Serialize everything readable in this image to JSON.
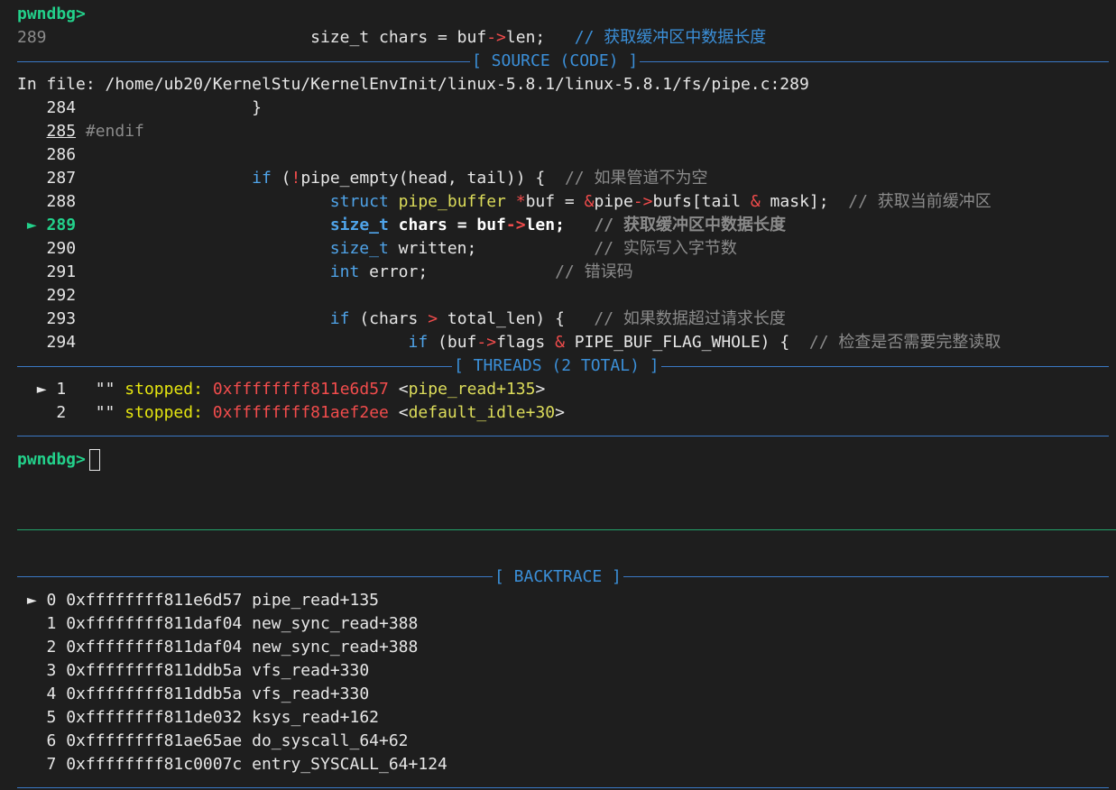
{
  "prompt": "pwndbg>",
  "top_line": {
    "lineno": "289",
    "code_a": "size_t chars = buf",
    "arrow": "->",
    "code_b": "len;",
    "comment": "// 获取缓冲区中数据长度"
  },
  "source": {
    "banner": "[ SOURCE (CODE) ]",
    "file_label": "In file: ",
    "file_path": "/home/ub20/KernelStu/KernelEnvInit/linux-5.8.1/linux-5.8.1/fs/pipe.c:289",
    "current_marker": "►",
    "lines": [
      {
        "no": "284",
        "text": "}"
      },
      {
        "no": "285",
        "text": "#endif"
      },
      {
        "no": "286",
        "text": ""
      },
      {
        "no": "287",
        "kw": "if",
        "p1": " (",
        "not": "!",
        "fn": "pipe_empty",
        "rest": "(head, tail)) {  ",
        "comment": "// 如果管道不为空"
      },
      {
        "no": "288",
        "kw": "struct",
        "type": "pipe_buffer",
        "star": " *",
        "rest1": "buf = ",
        "amp": "&",
        "rest2": "pipe",
        "arrow": "->",
        "rest3": "bufs[tail ",
        "amp2": "&",
        "rest4": " mask];  ",
        "comment": "// 获取当前缓冲区"
      },
      {
        "no": "289",
        "kw": "size_t",
        "rest1": " chars = buf",
        "arrow": "->",
        "rest2": "len;   ",
        "comment": "// 获取缓冲区中数据长度"
      },
      {
        "no": "290",
        "kw": "size_t",
        "rest1": " written;            ",
        "comment": "// 实际写入字节数"
      },
      {
        "no": "291",
        "kw": "int",
        "rest1": " error;             ",
        "comment": "// 错误码"
      },
      {
        "no": "292",
        "text": ""
      },
      {
        "no": "293",
        "kw": "if",
        "rest1": " (chars ",
        "gt": ">",
        "rest2": " total_len) {   ",
        "comment": "// 如果数据超过请求长度"
      },
      {
        "no": "294",
        "kw": "if",
        "rest1": " (buf",
        "arrow": "->",
        "rest2": "flags ",
        "amp": "&",
        "rest3": " PIPE_BUF_FLAG_WHOLE) {  ",
        "comment": "// 检查是否需要完整读取"
      }
    ]
  },
  "threads": {
    "banner": "[ THREADS (2 TOTAL) ]",
    "current_marker": "►",
    "items": [
      {
        "id": "1",
        "name": "\"\"",
        "state": "stopped:",
        "addr": "0xffffffff811e6d57",
        "sym": "pipe_read+135"
      },
      {
        "id": "2",
        "name": "\"\"",
        "state": "stopped:",
        "addr": "0xffffffff81aef2ee",
        "sym": "default_idle+30"
      }
    ]
  },
  "backtrace": {
    "banner": "[ BACKTRACE ]",
    "current_marker": "►",
    "frames": [
      {
        "n": "0",
        "addr": "0xffffffff811e6d57",
        "sym": "pipe_read+135"
      },
      {
        "n": "1",
        "addr": "0xffffffff811daf04",
        "sym": "new_sync_read+388"
      },
      {
        "n": "2",
        "addr": "0xffffffff811daf04",
        "sym": "new_sync_read+388"
      },
      {
        "n": "3",
        "addr": "0xffffffff811ddb5a",
        "sym": "vfs_read+330"
      },
      {
        "n": "4",
        "addr": "0xffffffff811ddb5a",
        "sym": "vfs_read+330"
      },
      {
        "n": "5",
        "addr": "0xffffffff811de032",
        "sym": "ksys_read+162"
      },
      {
        "n": "6",
        "addr": "0xffffffff81ae65ae",
        "sym": "do_syscall_64+62"
      },
      {
        "n": "7",
        "addr": "0xffffffff81c0007c",
        "sym": "entry_SYSCALL_64+124"
      }
    ]
  },
  "colors": {
    "background": "#1e1e1e",
    "prompt": "#23d18b",
    "banner": "#3b8fd8",
    "rule": "#3a78c4",
    "address": "#f14c4c",
    "stopped": "#e5e510"
  }
}
